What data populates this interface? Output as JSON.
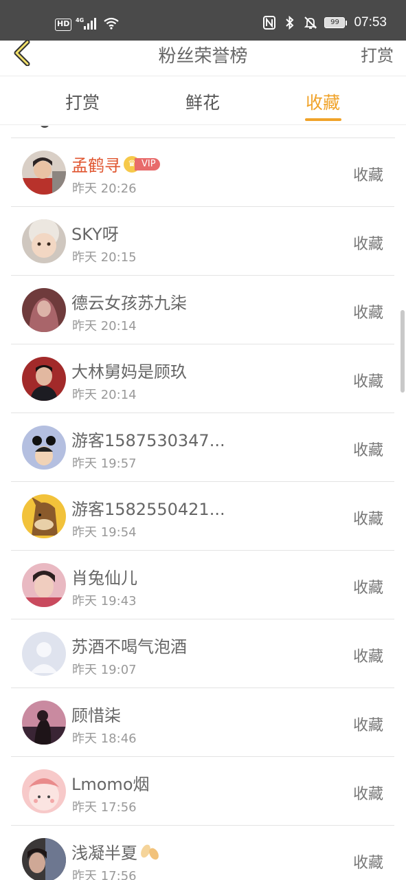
{
  "status_bar": {
    "hd": "HD",
    "network": "4G",
    "battery": "99",
    "time": "07:53",
    "icons": [
      "signal-icon",
      "wifi-icon",
      "nfc-icon",
      "bluetooth-icon",
      "mute-bell-icon",
      "battery-icon"
    ]
  },
  "header": {
    "back_icon": "chevron-left-icon",
    "title": "粉丝荣誉榜",
    "right_link": "打赏"
  },
  "tabs": [
    {
      "label": "打赏",
      "active": false
    },
    {
      "label": "鲜花",
      "active": false
    },
    {
      "label": "收藏",
      "active": true
    }
  ],
  "accent_color": "#f0a32a",
  "vip_name_color": "#e0552f",
  "rows": [
    {
      "name": "孟鹤寻",
      "time": "昨天 20:26",
      "action": "收藏",
      "vip": true,
      "vip_label": "VIP"
    },
    {
      "name": "SKY呀",
      "time": "昨天 20:15",
      "action": "收藏"
    },
    {
      "name": "德云女孩苏九柒",
      "time": "昨天 20:14",
      "action": "收藏"
    },
    {
      "name": "大林舅妈是顾玖",
      "time": "昨天 20:14",
      "action": "收藏"
    },
    {
      "name": "游客1587530347...",
      "time": "昨天 19:57",
      "action": "收藏"
    },
    {
      "name": "游客1582550421...",
      "time": "昨天 19:54",
      "action": "收藏"
    },
    {
      "name": "肖兔仙儿",
      "time": "昨天 19:43",
      "action": "收藏"
    },
    {
      "name": "苏酒不喝气泡酒",
      "time": "昨天 19:07",
      "action": "收藏"
    },
    {
      "name": "顾惜柒",
      "time": "昨天 18:46",
      "action": "收藏"
    },
    {
      "name": "Lmomo烟",
      "time": "昨天 17:56",
      "action": "收藏"
    },
    {
      "name": "浅凝半夏",
      "time": "昨天 17:56",
      "action": "收藏"
    }
  ]
}
